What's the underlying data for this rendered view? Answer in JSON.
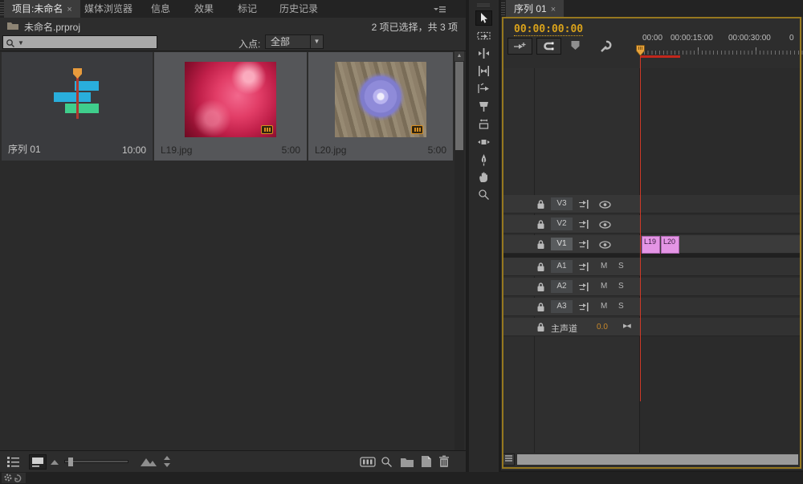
{
  "colors": {
    "accent-orange": "#d9a21b",
    "playhead-red": "#d03a28",
    "render-red": "#c2271c",
    "clip-fill": "#e495e5",
    "clip-border": "#a963ac",
    "clip-text": "#3c1c40",
    "focus-border": "#96781f",
    "seq-cyan": "#29aedc",
    "seq-green": "#3fce8c",
    "seq-orange": "#e89b3c",
    "seq-red": "#b0392f",
    "badge-orange": "#d78e20"
  },
  "project_panel": {
    "tabs": [
      {
        "label": "项目:未命名",
        "close": "×"
      },
      {
        "label": "媒体浏览器"
      },
      {
        "label": "信息"
      },
      {
        "label": "效果"
      },
      {
        "label": "标记"
      },
      {
        "label": "历史记录"
      }
    ],
    "breadcrumb": "未命名.prproj",
    "selection_status": "2 项已选择，共 3 项",
    "search_value": "",
    "filter_label": "入点:",
    "filter_value": "全部",
    "items": [
      {
        "name": "序列 01",
        "duration": "10:00",
        "type": "sequence",
        "selected": false
      },
      {
        "name": "L19.jpg",
        "duration": "5:00",
        "type": "image",
        "selected": true
      },
      {
        "name": "L20.jpg",
        "duration": "5:00",
        "type": "image",
        "selected": true
      }
    ]
  },
  "tools": [
    "selection",
    "track-select-forward",
    "ripple-edit",
    "rolling-edit",
    "rate-stretch",
    "razor",
    "slip",
    "slide",
    "pen",
    "hand",
    "zoom"
  ],
  "timeline": {
    "tab": {
      "label": "序列 01",
      "close": "×"
    },
    "playhead_timecode": "00:00:00:00",
    "ruler_labels": [
      "00:00",
      "00:00:15:00",
      "00:00:30:00",
      "0"
    ],
    "video_tracks": [
      {
        "name": "V3",
        "targeted": false
      },
      {
        "name": "V2",
        "targeted": false
      },
      {
        "name": "V1",
        "targeted": true
      }
    ],
    "audio_tracks": [
      {
        "name": "A1",
        "mute": "M",
        "solo": "S"
      },
      {
        "name": "A2",
        "mute": "M",
        "solo": "S"
      },
      {
        "name": "A3",
        "mute": "M",
        "solo": "S"
      }
    ],
    "master": {
      "name": "主声道",
      "value": "0.0"
    },
    "clips": [
      {
        "label": "L19"
      },
      {
        "label": "L20"
      }
    ]
  }
}
